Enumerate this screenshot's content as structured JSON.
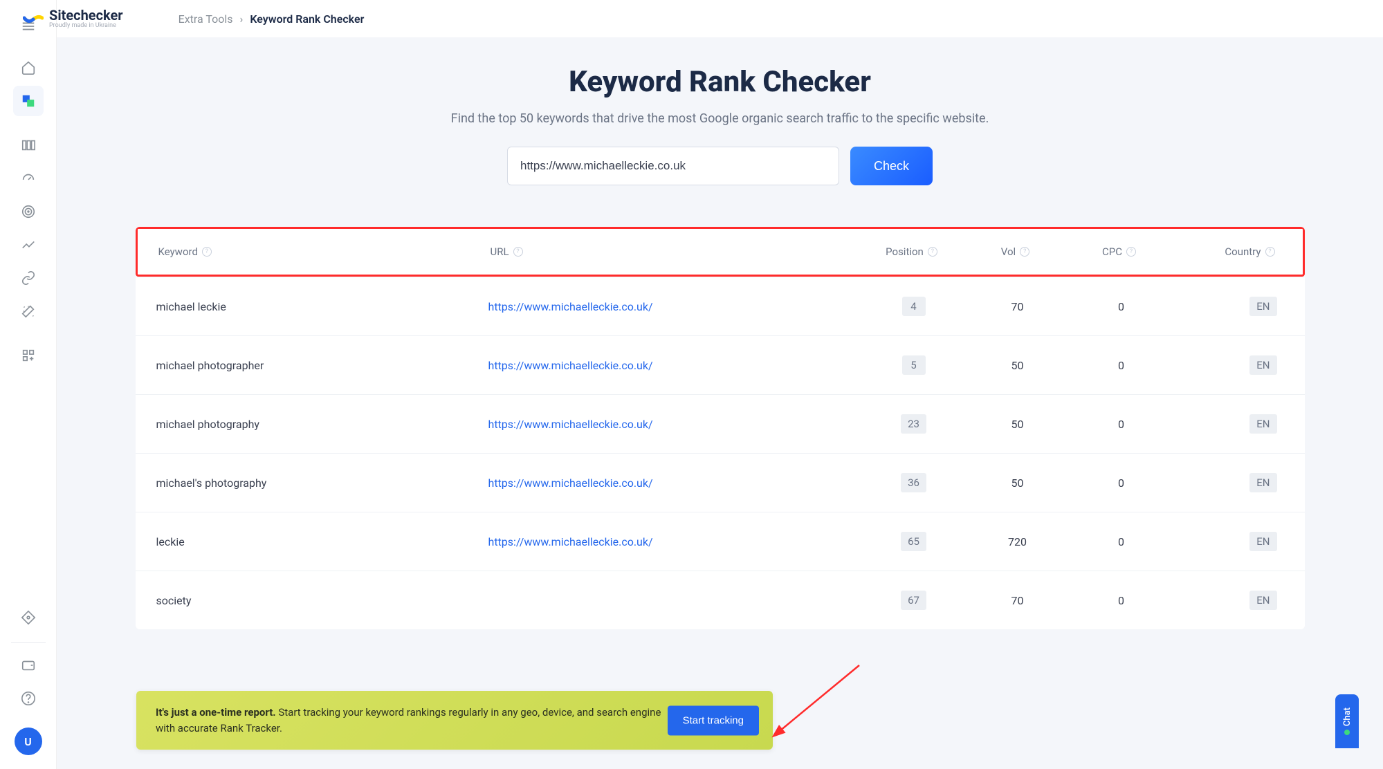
{
  "brand": {
    "name": "Sitechecker",
    "tagline": "Proudly made in Ukraine"
  },
  "breadcrumb": {
    "parent": "Extra Tools",
    "current": "Keyword Rank Checker"
  },
  "page": {
    "title": "Keyword Rank Checker",
    "subtitle": "Find the top 50 keywords that drive the most Google organic search traffic to the specific website.",
    "url_value": "https://www.michaelleckie.co.uk",
    "check_label": "Check"
  },
  "table": {
    "headers": {
      "keyword": "Keyword",
      "url": "URL",
      "position": "Position",
      "vol": "Vol",
      "cpc": "CPC",
      "country": "Country"
    },
    "rows": [
      {
        "keyword": "michael leckie",
        "url": "https://www.michaelleckie.co.uk/",
        "position": "4",
        "vol": "70",
        "cpc": "0",
        "country": "EN"
      },
      {
        "keyword": "michael photographer",
        "url": "https://www.michaelleckie.co.uk/",
        "position": "5",
        "vol": "50",
        "cpc": "0",
        "country": "EN"
      },
      {
        "keyword": "michael photography",
        "url": "https://www.michaelleckie.co.uk/",
        "position": "23",
        "vol": "50",
        "cpc": "0",
        "country": "EN"
      },
      {
        "keyword": "michael's photography",
        "url": "https://www.michaelleckie.co.uk/",
        "position": "36",
        "vol": "50",
        "cpc": "0",
        "country": "EN"
      },
      {
        "keyword": "leckie",
        "url": "https://www.michaelleckie.co.uk/",
        "position": "65",
        "vol": "720",
        "cpc": "0",
        "country": "EN"
      },
      {
        "keyword": "society",
        "url": "",
        "position": "67",
        "vol": "70",
        "cpc": "0",
        "country": "EN"
      }
    ]
  },
  "callout": {
    "bold": "It's just a one-time report.",
    "rest": " Start tracking your keyword rankings regularly in any geo, device, and search engine with accurate Rank Tracker.",
    "button": "Start tracking"
  },
  "chat": {
    "label": "Chat"
  },
  "avatar": {
    "initial": "U"
  }
}
